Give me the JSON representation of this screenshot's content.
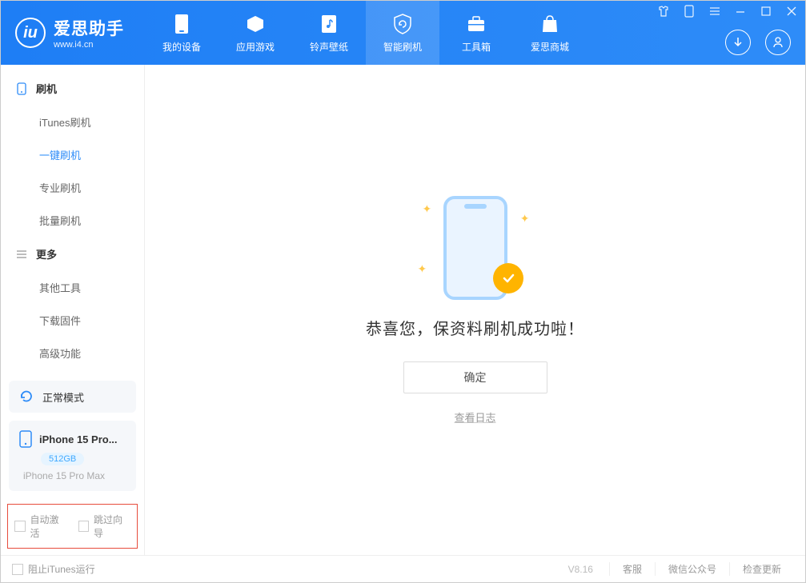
{
  "app": {
    "title": "爱思助手",
    "subtitle": "www.i4.cn"
  },
  "nav": {
    "items": [
      {
        "label": "我的设备"
      },
      {
        "label": "应用游戏"
      },
      {
        "label": "铃声壁纸"
      },
      {
        "label": "智能刷机"
      },
      {
        "label": "工具箱"
      },
      {
        "label": "爱思商城"
      }
    ]
  },
  "sidebar": {
    "group1": {
      "title": "刷机",
      "items": [
        "iTunes刷机",
        "一键刷机",
        "专业刷机",
        "批量刷机"
      ]
    },
    "group2": {
      "title": "更多",
      "items": [
        "其他工具",
        "下载固件",
        "高级功能"
      ]
    },
    "mode": "正常模式",
    "device": {
      "name": "iPhone 15 Pro...",
      "storage": "512GB",
      "model": "iPhone 15 Pro Max"
    },
    "checkbox1": "自动激活",
    "checkbox2": "跳过向导"
  },
  "main": {
    "title": "恭喜您，保资料刷机成功啦！",
    "ok_button": "确定",
    "view_log": "查看日志"
  },
  "footer": {
    "block_itunes": "阻止iTunes运行",
    "version": "V8.16",
    "items": [
      "客服",
      "微信公众号",
      "检查更新"
    ]
  }
}
